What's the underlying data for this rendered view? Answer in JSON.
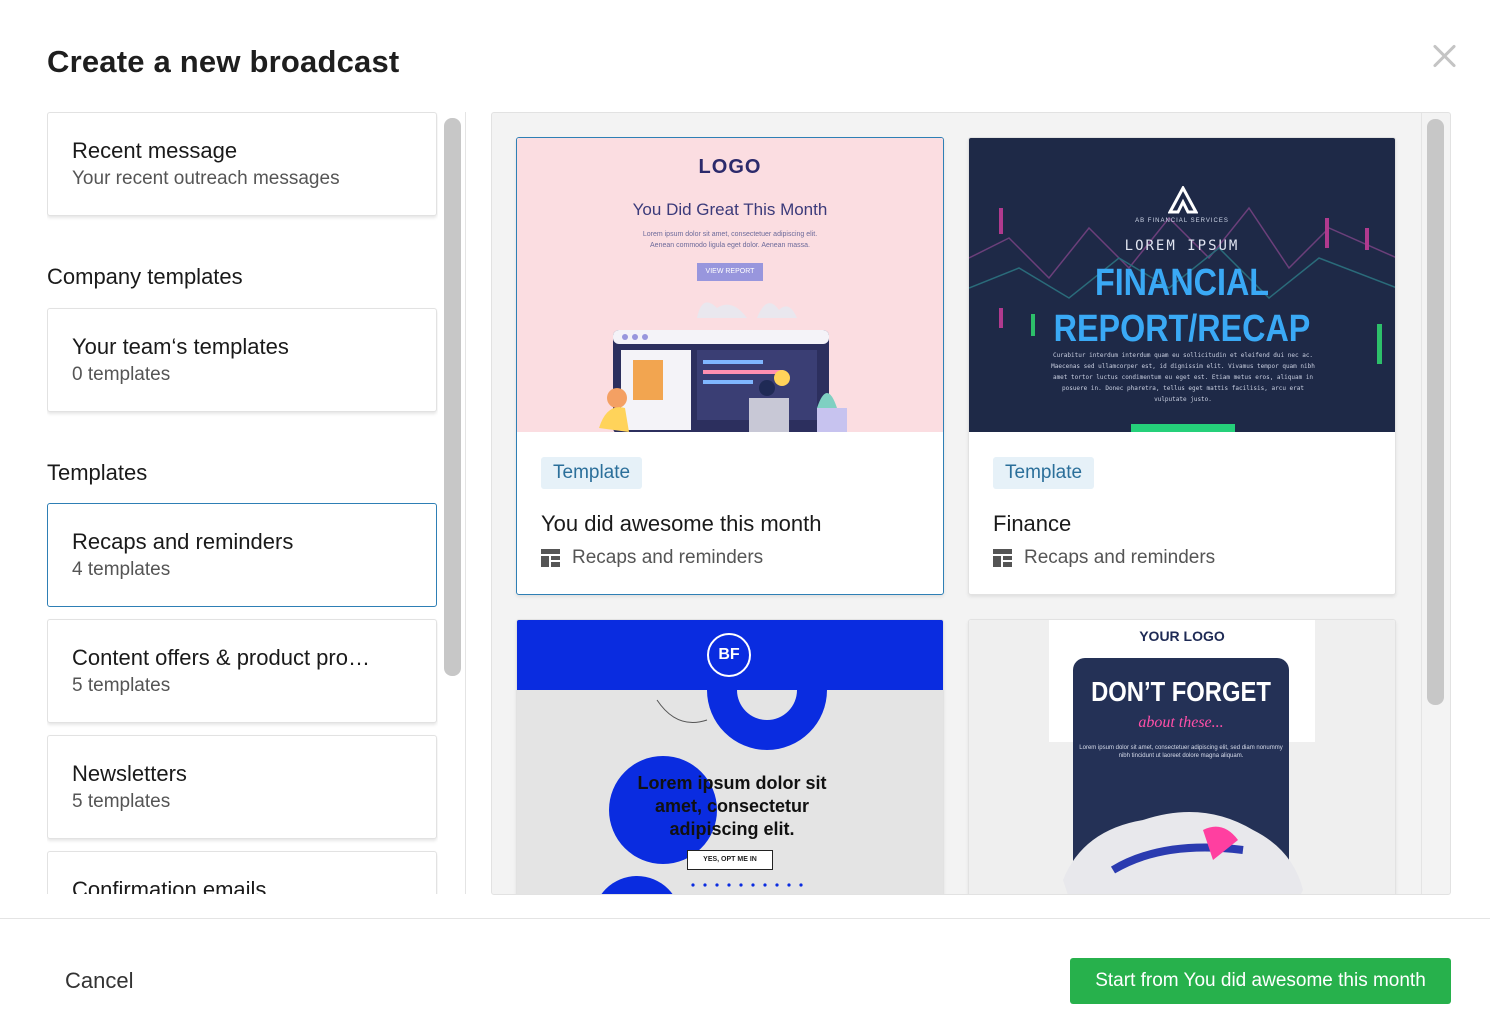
{
  "dialog": {
    "title": "Create a new broadcast",
    "close_label": "Close"
  },
  "sidebar": {
    "recent": {
      "title": "Recent message",
      "subtitle": "Your recent outreach messages"
    },
    "company_heading": "Company templates",
    "team": {
      "title": "Your team‘s templates",
      "subtitle": "0 templates"
    },
    "templates_heading": "Templates",
    "categories": [
      {
        "title": "Recaps and reminders",
        "subtitle": "4 templates",
        "selected": true
      },
      {
        "title": "Content offers & product pro…",
        "subtitle": "5 templates",
        "selected": false
      },
      {
        "title": "Newsletters",
        "subtitle": "5 templates",
        "selected": false
      },
      {
        "title": "Confirmation emails",
        "subtitle": "",
        "selected": false
      }
    ]
  },
  "templates": [
    {
      "badge": "Template",
      "name": "You did awesome this month",
      "category": "Recaps and reminders",
      "selected": true,
      "preview": {
        "logo": "LOGO",
        "heading": "You Did Great This Month",
        "body_1": "Lorem ipsum dolor sit amet, consectetuer adipiscing elit.",
        "body_2": "Aenean commodo ligula eget dolor. Aenean massa.",
        "button": "VIEW REPORT"
      }
    },
    {
      "badge": "Template",
      "name": "Finance",
      "category": "Recaps and reminders",
      "selected": false,
      "preview": {
        "brand": "AB FINANCIAL SERVICES",
        "kicker": "LOREM IPSUM",
        "title_1": "FINANCIAL",
        "title_2": "REPORT/RECAP",
        "body": "Curabitur interdum interdum quam eu sollicitudin et eleifend dui nec ac. Maecenas sed ullamcorper est, id dignissim elit. Vivamus tempor quam nibh amet tortor luctus condimentum eu eget est. Etiam metus eros, aliquam in posuere in. Donec pharetra, tellus eget mattis facilisis, arcu erat vulputate justo."
      }
    },
    {
      "preview": {
        "initials": "BF",
        "text": "Lorem ipsum dolor sit amet, consectetur adipiscing elit.",
        "button": "YES, OPT ME IN"
      }
    },
    {
      "preview": {
        "logo": "YOUR LOGO",
        "title": "DON’T FORGET",
        "subtitle": "about these...",
        "body": "Lorem ipsum dolor sit amet, consectetuer adipiscing elit, sed diam nonummy nibh tincidunt ut laoreet dolore magna aliquam."
      }
    }
  ],
  "footer": {
    "cancel": "Cancel",
    "primary": "Start from You did awesome this month"
  },
  "colors": {
    "accent_blue": "#2e7fb5",
    "primary_green": "#27b14c",
    "badge_bg": "#e6f1f8",
    "badge_text": "#2b6f9a"
  }
}
